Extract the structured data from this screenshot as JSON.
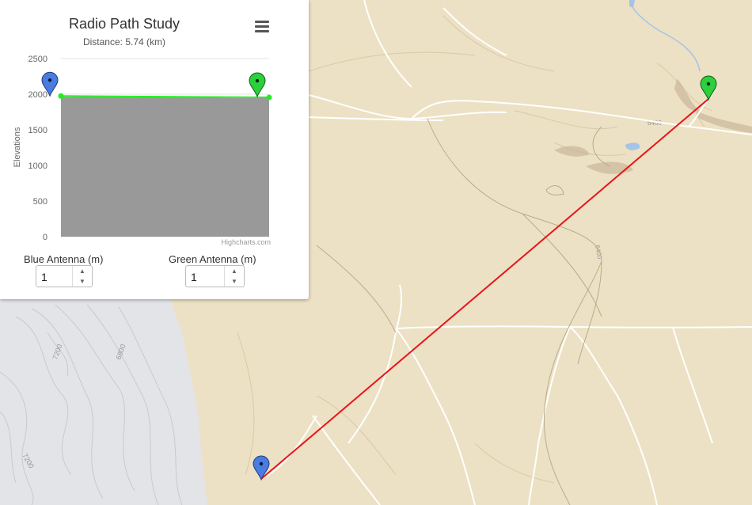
{
  "chart": {
    "title": "Radio Path Study",
    "subtitle": "Distance: 5.74 (km)",
    "ylabel": "Elevations",
    "credit": "Highcharts.com",
    "menu_icon": "hamburger-icon"
  },
  "chart_data": {
    "type": "area",
    "title": "Radio Path Study",
    "subtitle": "Distance: 5.74 (km)",
    "ylabel": "Elevations",
    "ylim": [
      0,
      2500
    ],
    "yticks": [
      0,
      500,
      1000,
      1500,
      2000,
      2500
    ],
    "grid": true,
    "terrain": {
      "name": "",
      "color": "#999999",
      "values": [
        1962,
        1961,
        1960,
        1958,
        1957,
        1955,
        1954,
        1952,
        1950,
        1948,
        1945,
        1944
      ]
    },
    "path": {
      "name": "",
      "color": "#22ee22",
      "start": 1975,
      "end": 1955
    },
    "colors": {
      "blue_marker": "#4a7be0",
      "green_marker": "#2bd03c"
    }
  },
  "antennas": {
    "blue": {
      "label": "Blue Antenna (m)",
      "value": "1"
    },
    "green": {
      "label": "Green Antenna (m)",
      "value": "1"
    }
  },
  "map": {
    "contour_labels": [
      "7200",
      "6800",
      "7200",
      "6400",
      "6400"
    ],
    "path_color": "#e8141c"
  }
}
